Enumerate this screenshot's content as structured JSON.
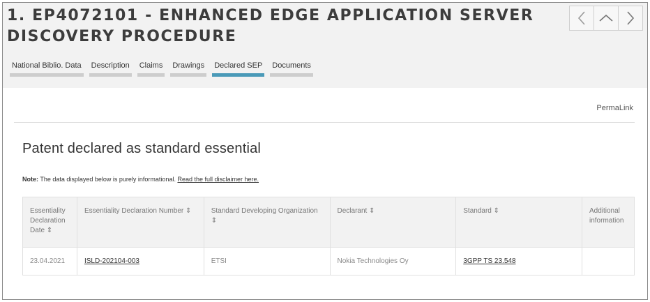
{
  "header": {
    "title": "1. EP4072101 - ENHANCED EDGE APPLICATION SERVER DISCOVERY PROCEDURE"
  },
  "nav": {
    "prev_icon": "chevron-left-icon",
    "up_icon": "chevron-up-icon",
    "next_icon": "chevron-right-icon"
  },
  "tabs": [
    {
      "label": "National Biblio. Data",
      "active": false
    },
    {
      "label": "Description",
      "active": false
    },
    {
      "label": "Claims",
      "active": false
    },
    {
      "label": "Drawings",
      "active": false
    },
    {
      "label": "Declared SEP",
      "active": true
    },
    {
      "label": "Documents",
      "active": false
    }
  ],
  "permalink": "PermaLink",
  "section_title": "Patent declared as standard essential",
  "note": {
    "label": "Note:",
    "text": " The data displayed below is purely informational. ",
    "link": "Read the full disclaimer here."
  },
  "table": {
    "headers": [
      "Essentiality Declaration Date ⇕",
      "Essentiality Declaration Number ⇕",
      "Standard Developing Organization ⇕",
      "Declarant ⇕",
      "Standard ⇕",
      "Additional information"
    ],
    "rows": [
      {
        "date": "23.04.2021",
        "number": "ISLD-202104-003",
        "org": "ETSI",
        "declarant": "Nokia Technologies Oy",
        "standard": "3GPP TS 23.548",
        "additional": ""
      }
    ]
  },
  "colors": {
    "header_bg": "#f2f2f2",
    "active_tab": "#4a9ab8",
    "inactive_tab": "#cdcdcd"
  }
}
